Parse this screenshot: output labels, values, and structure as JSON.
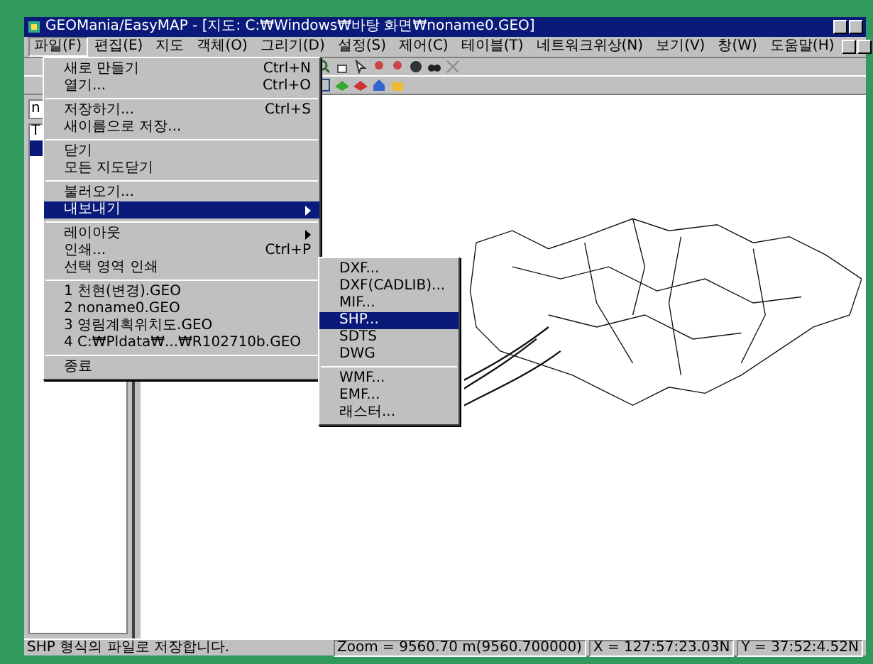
{
  "window": {
    "title": "GEOMania/EasyMAP - [지도: C:₩Windows₩바탕 화면₩noname0.GEO]"
  },
  "menubar": [
    {
      "label": "파일(F)",
      "selected": true
    },
    {
      "label": "편집(E)",
      "selected": false
    },
    {
      "label": "지도",
      "selected": false
    },
    {
      "label": "객체(O)",
      "selected": false
    },
    {
      "label": "그리기(D)",
      "selected": false
    },
    {
      "label": "설정(S)",
      "selected": false
    },
    {
      "label": "제어(C)",
      "selected": false
    },
    {
      "label": "테이블(T)",
      "selected": false
    },
    {
      "label": "네트워크위상(N)",
      "selected": false
    },
    {
      "label": "보기(V)",
      "selected": false
    },
    {
      "label": "창(W)",
      "selected": false
    },
    {
      "label": "도움말(H)",
      "selected": false
    }
  ],
  "file_menu": [
    {
      "kind": "item",
      "label": "새로 만들기",
      "shortcut": "Ctrl+N",
      "selected": false,
      "submenu": false
    },
    {
      "kind": "item",
      "label": "열기...",
      "shortcut": "Ctrl+O",
      "selected": false,
      "submenu": false
    },
    {
      "kind": "separator"
    },
    {
      "kind": "item",
      "label": "저장하기...",
      "shortcut": "Ctrl+S",
      "selected": false,
      "submenu": false
    },
    {
      "kind": "item",
      "label": "새이름으로 저장...",
      "selected": false,
      "submenu": false
    },
    {
      "kind": "separator"
    },
    {
      "kind": "item",
      "label": "닫기",
      "selected": false,
      "submenu": false
    },
    {
      "kind": "item",
      "label": "모든 지도닫기",
      "selected": false,
      "submenu": false
    },
    {
      "kind": "separator"
    },
    {
      "kind": "item",
      "label": "불러오기...",
      "selected": false,
      "submenu": false
    },
    {
      "kind": "item",
      "label": "내보내기",
      "selected": true,
      "submenu": true
    },
    {
      "kind": "separator"
    },
    {
      "kind": "item",
      "label": "레이아웃",
      "selected": false,
      "submenu": true
    },
    {
      "kind": "item",
      "label": "인쇄...",
      "shortcut": "Ctrl+P",
      "selected": false,
      "submenu": false
    },
    {
      "kind": "item",
      "label": "선택 영역 인쇄",
      "selected": false,
      "submenu": false
    },
    {
      "kind": "separator"
    },
    {
      "kind": "item",
      "label": "1 천현(변경).GEO",
      "selected": false,
      "submenu": false
    },
    {
      "kind": "item",
      "label": "2 noname0.GEO",
      "selected": false,
      "submenu": false
    },
    {
      "kind": "item",
      "label": "3 영림계획위치도.GEO",
      "selected": false,
      "submenu": false
    },
    {
      "kind": "item",
      "label": "4 C:₩Pldata₩...₩R102710b.GEO",
      "selected": false,
      "submenu": false
    },
    {
      "kind": "separator"
    },
    {
      "kind": "item",
      "label": "종료",
      "selected": false,
      "submenu": false
    }
  ],
  "export_submenu": [
    {
      "kind": "item",
      "label": "DXF...",
      "selected": false
    },
    {
      "kind": "item",
      "label": "DXF(CADLIB)...",
      "selected": false
    },
    {
      "kind": "item",
      "label": "MIF...",
      "selected": false
    },
    {
      "kind": "item",
      "label": "SHP...",
      "selected": true
    },
    {
      "kind": "item",
      "label": "SDTS",
      "selected": false
    },
    {
      "kind": "item",
      "label": "DWG",
      "selected": false
    },
    {
      "kind": "separator"
    },
    {
      "kind": "item",
      "label": "WMF...",
      "selected": false
    },
    {
      "kind": "item",
      "label": "EMF...",
      "selected": false
    },
    {
      "kind": "item",
      "label": "래스터...",
      "selected": false
    }
  ],
  "layer_panel": {
    "field_value": "n",
    "items": [
      {
        "label": "T",
        "selected": false
      },
      {
        "selected": true
      }
    ]
  },
  "status_bar": {
    "message": "SHP 형식의 파일로 저장합니다.",
    "panes": [
      "Zoom = 9560.70  m(9560.700000)",
      "X = 127:57:23.03N",
      "Y = 37:52:4.52N"
    ]
  }
}
